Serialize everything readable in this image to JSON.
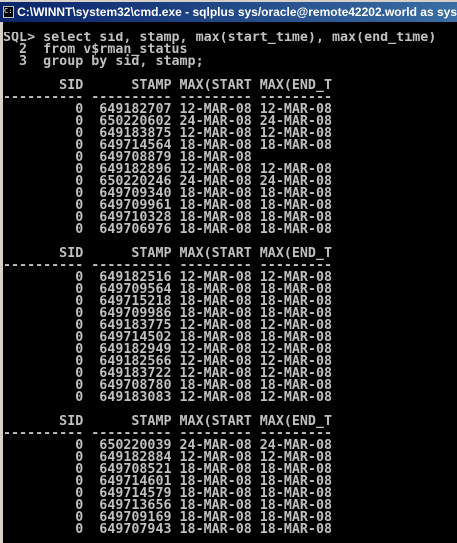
{
  "window": {
    "title": "C:\\WINNT\\system32\\cmd.exe - sqlplus sys/oracle@remote42202.world as sys",
    "icon": "cmd-icon"
  },
  "query": [
    "SQL> select sid, stamp, max(start_time), max(end_time)",
    "  2  from v$rman_status",
    "  3  group by sid, stamp;"
  ],
  "columns": [
    "SID",
    "STAMP",
    "MAX(START",
    "MAX(END_T"
  ],
  "groups": [
    [
      [
        "0",
        "649182707",
        "12-MAR-08",
        "12-MAR-08"
      ],
      [
        "0",
        "650220602",
        "24-MAR-08",
        "24-MAR-08"
      ],
      [
        "0",
        "649183875",
        "12-MAR-08",
        "12-MAR-08"
      ],
      [
        "0",
        "649714564",
        "18-MAR-08",
        "18-MAR-08"
      ],
      [
        "0",
        "649708879",
        "18-MAR-08",
        ""
      ],
      [
        "0",
        "649182896",
        "12-MAR-08",
        "12-MAR-08"
      ],
      [
        "0",
        "650220246",
        "24-MAR-08",
        "24-MAR-08"
      ],
      [
        "0",
        "649709340",
        "18-MAR-08",
        "18-MAR-08"
      ],
      [
        "0",
        "649709961",
        "18-MAR-08",
        "18-MAR-08"
      ],
      [
        "0",
        "649710328",
        "18-MAR-08",
        "18-MAR-08"
      ],
      [
        "0",
        "649706976",
        "18-MAR-08",
        "18-MAR-08"
      ]
    ],
    [
      [
        "0",
        "649182516",
        "12-MAR-08",
        "12-MAR-08"
      ],
      [
        "0",
        "649709564",
        "18-MAR-08",
        "18-MAR-08"
      ],
      [
        "0",
        "649715218",
        "18-MAR-08",
        "18-MAR-08"
      ],
      [
        "0",
        "649709986",
        "18-MAR-08",
        "18-MAR-08"
      ],
      [
        "0",
        "649183775",
        "12-MAR-08",
        "12-MAR-08"
      ],
      [
        "0",
        "649714502",
        "18-MAR-08",
        "18-MAR-08"
      ],
      [
        "0",
        "649182949",
        "12-MAR-08",
        "12-MAR-08"
      ],
      [
        "0",
        "649182566",
        "12-MAR-08",
        "12-MAR-08"
      ],
      [
        "0",
        "649183722",
        "12-MAR-08",
        "12-MAR-08"
      ],
      [
        "0",
        "649708780",
        "18-MAR-08",
        "18-MAR-08"
      ],
      [
        "0",
        "649183083",
        "12-MAR-08",
        "12-MAR-08"
      ]
    ],
    [
      [
        "0",
        "650220039",
        "24-MAR-08",
        "24-MAR-08"
      ],
      [
        "0",
        "649182884",
        "12-MAR-08",
        "12-MAR-08"
      ],
      [
        "0",
        "649708521",
        "18-MAR-08",
        "18-MAR-08"
      ],
      [
        "0",
        "649714601",
        "18-MAR-08",
        "18-MAR-08"
      ],
      [
        "0",
        "649714579",
        "18-MAR-08",
        "18-MAR-08"
      ],
      [
        "0",
        "649713656",
        "18-MAR-08",
        "18-MAR-08"
      ],
      [
        "0",
        "649709169",
        "18-MAR-08",
        "18-MAR-08"
      ],
      [
        "0",
        "649707943",
        "18-MAR-08",
        "18-MAR-08"
      ]
    ]
  ]
}
